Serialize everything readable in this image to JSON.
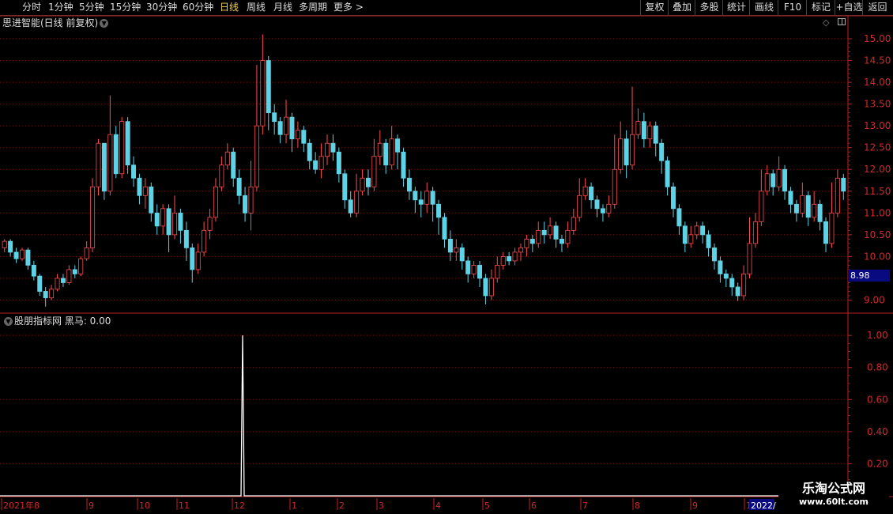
{
  "topbar": {
    "period_tabs": [
      {
        "label": "分时",
        "active": false
      },
      {
        "label": "1分钟",
        "active": false
      },
      {
        "label": "5分钟",
        "active": false
      },
      {
        "label": "15分钟",
        "active": false
      },
      {
        "label": "30分钟",
        "active": false
      },
      {
        "label": "60分钟",
        "active": false
      },
      {
        "label": "日线",
        "active": true
      },
      {
        "label": "周线",
        "active": false
      },
      {
        "label": "月线",
        "active": false
      },
      {
        "label": "多周期",
        "active": false
      },
      {
        "label": "更多 >",
        "active": false
      }
    ],
    "right_buttons": [
      "复权",
      "叠加",
      "多股",
      "统计",
      "画线",
      "F10",
      "标记",
      "+自选",
      "返回"
    ]
  },
  "main_chart": {
    "title": "思进智能(日线 前复权)",
    "last_price": "8.98",
    "y_ticks": [
      "15.00",
      "14.50",
      "14.00",
      "13.50",
      "13.00",
      "12.50",
      "12.00",
      "11.50",
      "11.00",
      "10.50",
      "10.00",
      "9.50",
      "9.00"
    ]
  },
  "indicator": {
    "title": "股朋指标网  黑马: 0.00",
    "y_ticks": [
      "1.00",
      "0.80",
      "0.60",
      "0.40",
      "0.20"
    ]
  },
  "x_axis": {
    "labels": [
      "2021年8",
      "9",
      "10",
      "11",
      "12",
      "1",
      "2",
      "3",
      "4",
      "5",
      "6",
      "7",
      "8",
      "9",
      "1",
      "2022/"
    ]
  },
  "watermark": {
    "line1": "乐淘公式网",
    "line2": "www.60lt.com"
  },
  "colors": {
    "up": "#ff4d4d",
    "down": "#5fd3e6",
    "grid": "#7a1010",
    "axis": "#c0201f",
    "bg": "#000000"
  },
  "chart_data": {
    "type": "candlestick",
    "ylim": [
      8.7,
      15.2
    ],
    "indicator_ylim": [
      0,
      1.05
    ],
    "indicator_spike": {
      "at_bar": 237,
      "value": 1.0
    },
    "candles": [
      [
        10.2,
        10.35,
        10.4,
        10.1
      ],
      [
        10.35,
        10.1,
        10.4,
        10.0
      ],
      [
        10.1,
        9.95,
        10.2,
        9.85
      ],
      [
        9.95,
        10.15,
        10.2,
        9.9
      ],
      [
        10.15,
        9.8,
        10.2,
        9.7
      ],
      [
        9.8,
        9.55,
        9.9,
        9.45
      ],
      [
        9.55,
        9.2,
        9.6,
        9.1
      ],
      [
        9.2,
        9.05,
        9.3,
        8.85
      ],
      [
        9.05,
        9.25,
        9.35,
        9.0
      ],
      [
        9.25,
        9.5,
        9.6,
        9.2
      ],
      [
        9.5,
        9.4,
        9.6,
        9.3
      ],
      [
        9.4,
        9.7,
        9.8,
        9.35
      ],
      [
        9.7,
        9.6,
        9.8,
        9.5
      ],
      [
        9.6,
        9.95,
        10.0,
        9.55
      ],
      [
        9.95,
        10.2,
        10.35,
        9.9
      ],
      [
        10.2,
        11.6,
        11.8,
        10.1
      ],
      [
        11.6,
        12.6,
        12.7,
        11.4
      ],
      [
        12.6,
        11.5,
        12.6,
        11.3
      ],
      [
        11.5,
        12.8,
        13.7,
        11.4
      ],
      [
        12.8,
        11.9,
        13.0,
        11.8
      ],
      [
        11.9,
        13.1,
        13.2,
        11.8
      ],
      [
        13.1,
        12.1,
        13.2,
        11.9
      ],
      [
        12.1,
        11.8,
        12.3,
        11.6
      ],
      [
        11.8,
        11.4,
        11.9,
        11.2
      ],
      [
        11.4,
        11.6,
        11.8,
        11.1
      ],
      [
        11.6,
        11.0,
        11.7,
        10.8
      ],
      [
        11.0,
        10.7,
        11.2,
        10.5
      ],
      [
        10.7,
        11.1,
        11.2,
        10.5
      ],
      [
        11.1,
        10.5,
        11.2,
        10.1
      ],
      [
        10.5,
        11.0,
        11.4,
        10.4
      ],
      [
        11.0,
        10.6,
        11.1,
        10.3
      ],
      [
        10.6,
        10.2,
        10.8,
        9.9
      ],
      [
        10.2,
        9.7,
        10.3,
        9.4
      ],
      [
        9.7,
        10.1,
        10.3,
        9.6
      ],
      [
        10.1,
        10.6,
        10.8,
        10.0
      ],
      [
        10.6,
        10.9,
        11.1,
        10.4
      ],
      [
        10.9,
        11.6,
        11.8,
        10.8
      ],
      [
        11.6,
        12.1,
        12.3,
        11.5
      ],
      [
        12.1,
        12.4,
        12.6,
        12.0
      ],
      [
        12.4,
        11.8,
        12.5,
        11.6
      ],
      [
        11.8,
        11.4,
        12.0,
        11.2
      ],
      [
        11.4,
        11.0,
        11.6,
        10.8
      ],
      [
        11.0,
        11.6,
        12.2,
        10.6
      ],
      [
        11.6,
        13.0,
        14.4,
        11.5
      ],
      [
        13.0,
        14.5,
        15.1,
        12.8
      ],
      [
        14.5,
        13.3,
        14.6,
        12.9
      ],
      [
        13.3,
        13.1,
        13.5,
        12.8
      ],
      [
        13.1,
        12.8,
        13.2,
        12.6
      ],
      [
        12.8,
        13.2,
        13.6,
        12.6
      ],
      [
        13.2,
        12.7,
        13.3,
        12.4
      ],
      [
        12.7,
        12.9,
        13.1,
        12.5
      ],
      [
        12.9,
        12.6,
        13.0,
        12.4
      ],
      [
        12.6,
        12.2,
        12.7,
        12.0
      ],
      [
        12.2,
        12.0,
        12.4,
        11.9
      ],
      [
        12.0,
        12.3,
        12.6,
        11.8
      ],
      [
        12.3,
        12.6,
        12.8,
        12.1
      ],
      [
        12.6,
        12.4,
        12.8,
        12.2
      ],
      [
        12.4,
        11.9,
        12.5,
        11.7
      ],
      [
        11.9,
        11.3,
        12.0,
        11.1
      ],
      [
        11.3,
        11.0,
        11.5,
        10.9
      ],
      [
        11.0,
        11.5,
        11.9,
        10.9
      ],
      [
        11.5,
        11.8,
        12.0,
        11.4
      ],
      [
        11.8,
        11.6,
        12.0,
        11.4
      ],
      [
        11.6,
        12.3,
        12.7,
        11.5
      ],
      [
        12.3,
        12.6,
        12.9,
        12.1
      ],
      [
        12.6,
        12.1,
        12.7,
        11.9
      ],
      [
        12.1,
        12.7,
        13.0,
        12.0
      ],
      [
        12.7,
        12.4,
        12.8,
        12.0
      ],
      [
        12.4,
        11.8,
        12.5,
        11.6
      ],
      [
        11.8,
        11.5,
        12.0,
        11.3
      ],
      [
        11.5,
        11.3,
        11.6,
        11.0
      ],
      [
        11.3,
        11.2,
        11.5,
        10.9
      ],
      [
        11.2,
        11.5,
        11.7,
        11.0
      ],
      [
        11.5,
        11.2,
        11.6,
        10.8
      ],
      [
        11.2,
        10.9,
        11.3,
        10.5
      ],
      [
        10.9,
        10.4,
        11.0,
        10.2
      ],
      [
        10.4,
        10.1,
        10.6,
        9.9
      ],
      [
        10.1,
        10.2,
        10.4,
        9.9
      ],
      [
        10.2,
        9.9,
        10.3,
        9.7
      ],
      [
        9.9,
        9.6,
        10.0,
        9.4
      ],
      [
        9.6,
        9.8,
        9.9,
        9.5
      ],
      [
        9.8,
        9.5,
        9.9,
        9.3
      ],
      [
        9.5,
        9.1,
        9.6,
        8.9
      ],
      [
        9.1,
        9.5,
        9.7,
        9.0
      ],
      [
        9.5,
        9.8,
        10.0,
        9.4
      ],
      [
        9.8,
        10.0,
        10.1,
        9.7
      ],
      [
        10.0,
        9.9,
        10.1,
        9.8
      ],
      [
        9.9,
        10.1,
        10.2,
        9.8
      ],
      [
        10.1,
        10.2,
        10.3,
        9.9
      ],
      [
        10.2,
        10.4,
        10.5,
        10.0
      ],
      [
        10.4,
        10.3,
        10.5,
        10.1
      ],
      [
        10.3,
        10.6,
        10.8,
        10.2
      ],
      [
        10.6,
        10.5,
        10.8,
        10.3
      ],
      [
        10.5,
        10.7,
        10.9,
        10.4
      ],
      [
        10.7,
        10.4,
        10.8,
        10.2
      ],
      [
        10.4,
        10.3,
        10.5,
        10.1
      ],
      [
        10.3,
        10.6,
        10.8,
        10.2
      ],
      [
        10.6,
        10.9,
        11.1,
        10.5
      ],
      [
        10.9,
        11.4,
        11.8,
        10.8
      ],
      [
        11.4,
        11.6,
        11.8,
        11.3
      ],
      [
        11.6,
        11.3,
        11.7,
        11.1
      ],
      [
        11.3,
        11.1,
        11.4,
        10.9
      ],
      [
        11.1,
        11.0,
        11.2,
        10.8
      ],
      [
        11.0,
        11.2,
        11.4,
        10.9
      ],
      [
        11.2,
        12.0,
        12.8,
        11.1
      ],
      [
        12.0,
        12.7,
        13.1,
        11.9
      ],
      [
        12.7,
        12.1,
        12.9,
        11.8
      ],
      [
        12.1,
        12.8,
        13.9,
        12.0
      ],
      [
        12.8,
        13.1,
        13.4,
        12.7
      ],
      [
        13.1,
        12.7,
        13.3,
        12.5
      ],
      [
        12.7,
        13.0,
        13.1,
        12.5
      ],
      [
        13.0,
        12.6,
        13.1,
        12.3
      ],
      [
        12.6,
        12.2,
        12.7,
        11.9
      ],
      [
        12.2,
        11.6,
        12.3,
        11.4
      ],
      [
        11.6,
        11.1,
        11.7,
        10.9
      ],
      [
        11.1,
        10.7,
        11.2,
        10.5
      ],
      [
        10.7,
        10.3,
        10.8,
        10.1
      ],
      [
        10.3,
        10.5,
        10.7,
        10.2
      ],
      [
        10.5,
        10.7,
        10.8,
        10.4
      ],
      [
        10.7,
        10.5,
        10.8,
        10.3
      ],
      [
        10.5,
        10.2,
        10.6,
        10.0
      ],
      [
        10.2,
        9.9,
        10.3,
        9.7
      ],
      [
        9.9,
        9.6,
        10.0,
        9.4
      ],
      [
        9.6,
        9.5,
        9.7,
        9.3
      ],
      [
        9.5,
        9.3,
        9.6,
        9.1
      ],
      [
        9.3,
        9.1,
        9.4,
        8.98
      ],
      [
        9.1,
        9.6,
        9.8,
        9.0
      ],
      [
        9.6,
        10.3,
        10.9,
        9.5
      ],
      [
        10.3,
        10.8,
        11.0,
        10.2
      ],
      [
        10.8,
        11.5,
        12.0,
        10.7
      ],
      [
        11.5,
        11.9,
        12.1,
        11.4
      ],
      [
        11.9,
        11.6,
        12.0,
        11.4
      ],
      [
        11.6,
        12.0,
        12.3,
        11.5
      ],
      [
        12.0,
        11.5,
        12.1,
        11.3
      ],
      [
        11.5,
        11.2,
        11.6,
        11.0
      ],
      [
        11.2,
        11.0,
        11.3,
        10.8
      ],
      [
        11.0,
        11.4,
        11.7,
        10.9
      ],
      [
        11.4,
        10.9,
        11.5,
        10.7
      ],
      [
        10.9,
        11.2,
        11.5,
        10.8
      ],
      [
        11.2,
        10.8,
        11.3,
        10.6
      ],
      [
        10.8,
        10.3,
        10.9,
        10.1
      ],
      [
        10.3,
        11.0,
        11.7,
        10.2
      ],
      [
        11.0,
        11.8,
        12.0,
        10.9
      ],
      [
        11.8,
        11.5,
        11.9,
        11.3
      ]
    ]
  }
}
